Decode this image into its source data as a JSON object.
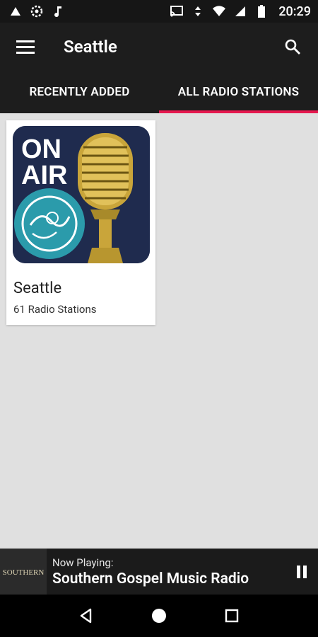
{
  "status_bar": {
    "time": "20:29",
    "left_icons": [
      "notification-icon",
      "settings-icon",
      "music-note-icon"
    ],
    "right_icons": [
      "cast-icon",
      "data-arrows-icon",
      "wifi-icon",
      "cellular-signal-icon",
      "battery-icon"
    ]
  },
  "app_bar": {
    "title": "Seattle",
    "menu_icon": "hamburger-menu-icon",
    "search_icon": "search-icon"
  },
  "tabs": [
    {
      "label": "RECENTLY ADDED",
      "active": false
    },
    {
      "label": "ALL RADIO STATIONS",
      "active": true
    }
  ],
  "colors": {
    "toolbar_bg": "#1d1d1d",
    "accent": "#e6194f",
    "content_bg": "#e0e0e0"
  },
  "cards": [
    {
      "title": "Seattle",
      "subtitle": "61 Radio Stations",
      "image": {
        "line1": "ON",
        "line2": "AIR",
        "description_icons": [
          "city-seal-icon",
          "microphone-icon"
        ]
      }
    }
  ],
  "now_playing": {
    "label": "Now Playing:",
    "title": "Southern Gospel Music Radio",
    "thumb_text": "SOUTHERN",
    "control": "pause-icon"
  },
  "nav_bar": [
    "back-icon",
    "home-icon",
    "recents-icon"
  ]
}
